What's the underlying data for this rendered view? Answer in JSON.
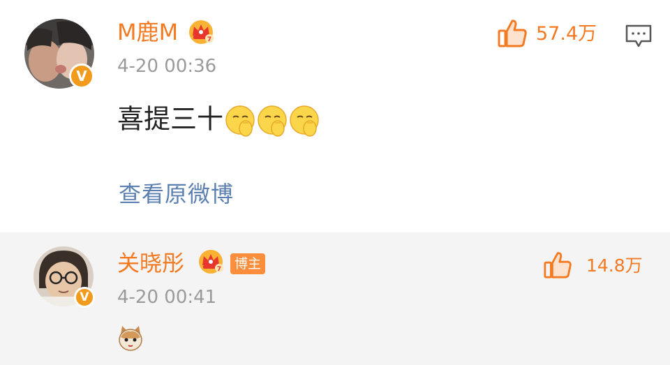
{
  "comments": [
    {
      "username": "M鹿M",
      "time": "4-20 00:36",
      "text": "喜提三十",
      "emoji_count": 3,
      "likes": "57.4万",
      "view_original": "查看原微博",
      "verified_badge": "V"
    },
    {
      "username": "关晓彤",
      "badge": "博主",
      "time": "4-20 00:41",
      "likes": "14.8万",
      "verified_badge": "V"
    }
  ],
  "colors": {
    "username": "#f47a22",
    "timestamp": "#9a9a9a",
    "link": "#5b7fb0",
    "second_row_bg": "#f4f4f4"
  }
}
